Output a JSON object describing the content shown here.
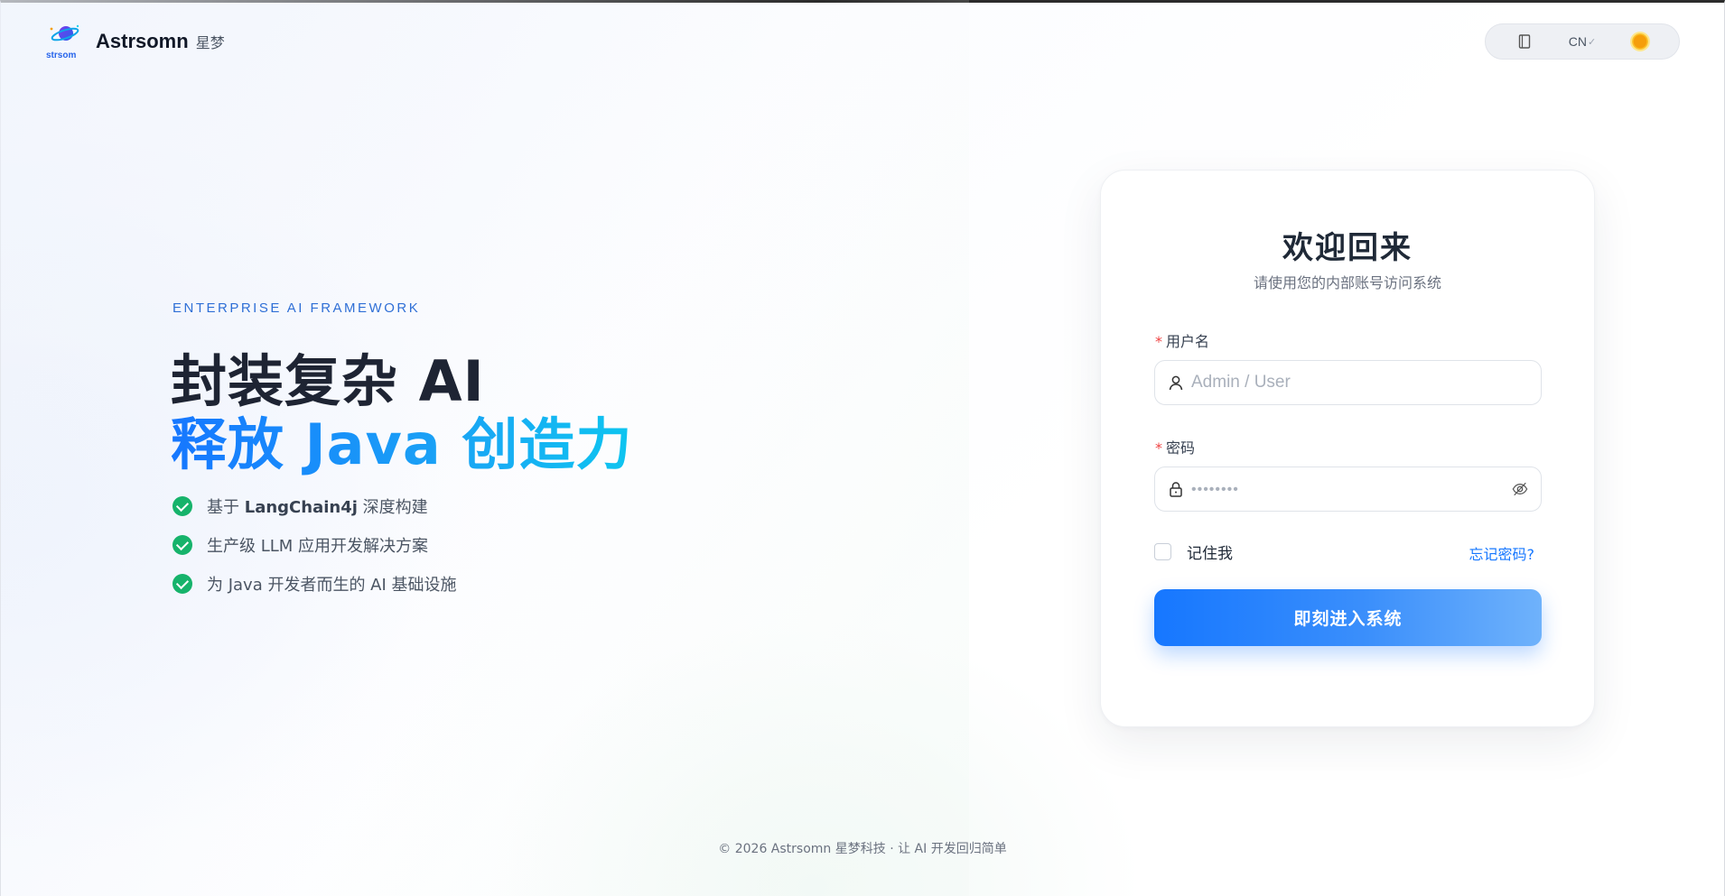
{
  "brand": {
    "logo_text": "strsom",
    "name": "Astrsomn",
    "subtitle": "星梦"
  },
  "toolbar": {
    "book_icon": "book-icon",
    "language": "CN",
    "theme_icon": "sun-icon"
  },
  "hero": {
    "eyebrow": "ENTERPRISE AI FRAMEWORK",
    "headline_line1": "封装复杂 AI",
    "headline_line2": "释放 Java 创造力",
    "accent_gradient": [
      "#1677ff",
      "#0ec5f0"
    ],
    "features": [
      {
        "prefix": "基于 ",
        "keyword": "LangChain4j",
        "suffix": " 深度构建"
      },
      {
        "prefix": "生产级 LLM 应用开发解决方案",
        "keyword": "",
        "suffix": ""
      },
      {
        "prefix": "为 Java 开发者而生的 AI 基础设施",
        "keyword": "",
        "suffix": ""
      }
    ]
  },
  "login": {
    "title": "欢迎回来",
    "subtitle": "请使用您的内部账号访问系统",
    "username_label": "用户名",
    "username_placeholder": "Admin / User",
    "password_label": "密码",
    "password_placeholder": "••••••••",
    "required_mark": "*",
    "remember_label": "记住我",
    "forgot_label": "忘记密码?",
    "submit_label": "即刻进入系统",
    "accent_color": "#1677ff"
  },
  "footer": {
    "text": "© 2026 Astrsomn 星梦科技 · 让 AI 开发回归简单"
  }
}
